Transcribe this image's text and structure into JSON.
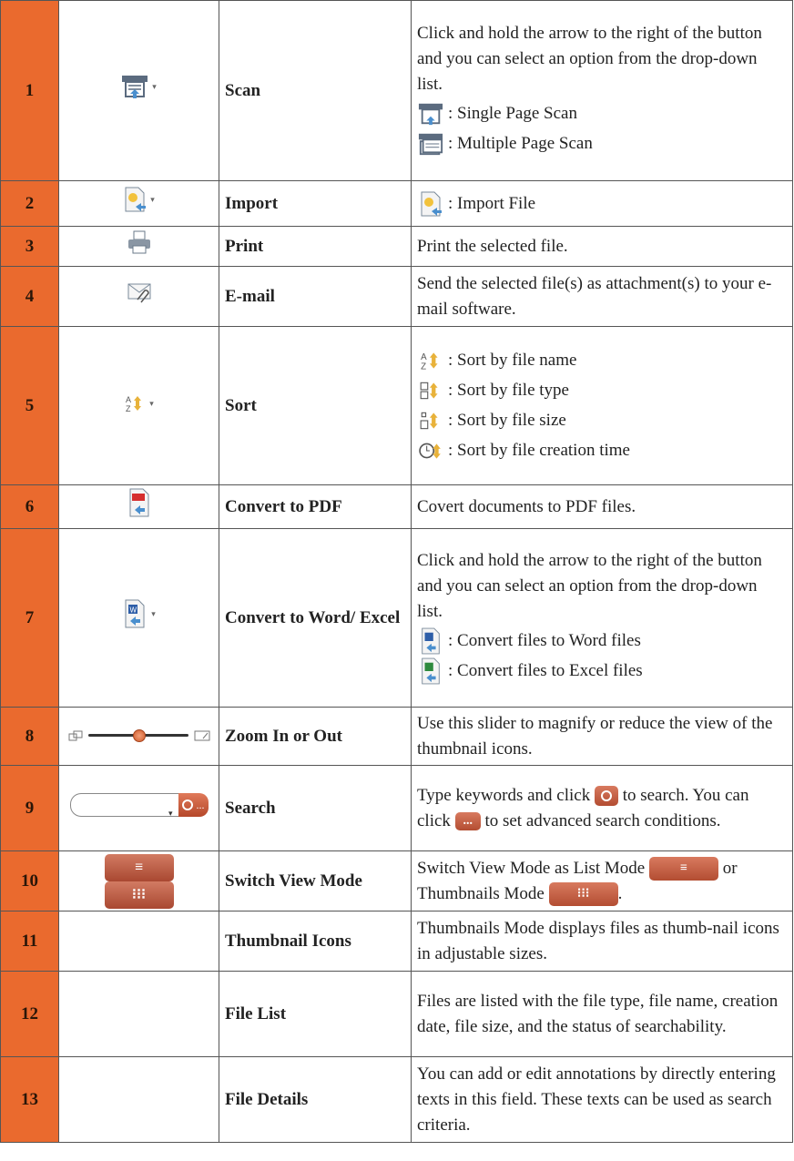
{
  "rows": [
    {
      "num": "1",
      "name": "Scan",
      "icon": "scan-icon",
      "desc_lines": [
        "Click and hold the arrow to the right of the button and you can select an option from the drop-down list."
      ],
      "sub_items": [
        {
          "icon": "single-page-scan-icon",
          "text": ": Single Page Scan"
        },
        {
          "icon": "multiple-page-scan-icon",
          "text": ": Multiple Page Scan"
        }
      ]
    },
    {
      "num": "2",
      "name": "Import",
      "icon": "import-icon",
      "sub_items": [
        {
          "icon": "import-file-icon",
          "text": ": Import File"
        }
      ]
    },
    {
      "num": "3",
      "name": "Print",
      "icon": "print-icon",
      "desc": "Print the selected file."
    },
    {
      "num": "4",
      "name": "E-mail",
      "icon": "email-icon",
      "desc": "Send the selected file(s) as attachment(s) to your e-mail software."
    },
    {
      "num": "5",
      "name": "Sort",
      "icon": "sort-icon",
      "sub_items": [
        {
          "icon": "sort-by-name-icon",
          "text": ":  Sort by file name"
        },
        {
          "icon": "sort-by-type-icon",
          "text": ":  Sort by file type"
        },
        {
          "icon": "sort-by-size-icon",
          "text": ":  Sort by file size"
        },
        {
          "icon": "sort-by-time-icon",
          "text": ":  Sort by file creation time"
        }
      ]
    },
    {
      "num": "6",
      "name": "Convert to PDF",
      "icon": "convert-pdf-icon",
      "desc": "Covert documents to PDF files."
    },
    {
      "num": "7",
      "name": "Convert to Word/ Excel",
      "icon": "convert-word-icon",
      "desc_lines": [
        "Click and hold the arrow to the right of the button and you can select an option from the drop-down list."
      ],
      "sub_items": [
        {
          "icon": "convert-word-icon",
          "text": ": Convert files to Word files"
        },
        {
          "icon": "convert-excel-icon",
          "text": ": Convert files to Excel files"
        }
      ]
    },
    {
      "num": "8",
      "name": "Zoom In or Out",
      "icon": "zoom-slider",
      "desc": "Use this slider to magnify or reduce the view of the thumbnail icons."
    },
    {
      "num": "9",
      "name": "Search",
      "icon": "search-box",
      "desc_a": "Type keywords and click",
      "desc_b": "to search. You can click",
      "desc_c": "to set advanced search conditions."
    },
    {
      "num": "10",
      "name": "Switch View Mode",
      "icon": "view-mode-buttons",
      "desc_a": "Switch View Mode as List Mode",
      "desc_b": "or Thumbnails Mode",
      "desc_c": "."
    },
    {
      "num": "11",
      "name": "Thumbnail Icons",
      "desc": "Thumbnails Mode displays files as thumb-nail icons in adjustable sizes."
    },
    {
      "num": "12",
      "name": "File List",
      "desc": "Files are listed with the file type, file name, creation date, file size, and the status of searchability."
    },
    {
      "num": "13",
      "name": "File Details",
      "desc": "You can add or edit annotations by directly entering texts in this field.  These texts can be used as search criteria."
    }
  ],
  "glyphs": {
    "list": "≡",
    "grid": "⁝⁝⁝",
    "dots": "..."
  },
  "zoom_level": 0.5,
  "colors": {
    "number_col": "#ea6a2e",
    "button": "#c0583c"
  }
}
